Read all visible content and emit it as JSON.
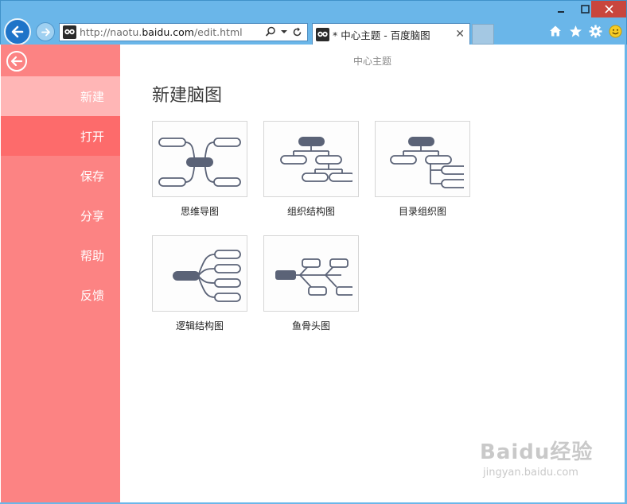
{
  "browser": {
    "url_prefix": "http://naotu.",
    "url_domain": "baidu.com",
    "url_path": "/edit.html",
    "tab_title": "* 中心主题 - 百度脑图",
    "window_controls": [
      "minimize-icon",
      "maximize-icon",
      "close-icon"
    ],
    "toolbar_icons": [
      "home-icon",
      "favorites-star-icon",
      "settings-gear-icon",
      "feedback-smiley-icon"
    ]
  },
  "sidebar": {
    "items": [
      {
        "label": "新建",
        "state": "selected"
      },
      {
        "label": "打开",
        "state": "hover"
      },
      {
        "label": "保存",
        "state": "normal"
      },
      {
        "label": "分享",
        "state": "normal"
      },
      {
        "label": "帮助",
        "state": "normal"
      },
      {
        "label": "反馈",
        "state": "normal"
      }
    ]
  },
  "main": {
    "doc_title": "中心主题",
    "heading": "新建脑图",
    "templates": [
      {
        "label": "思维导图",
        "icon": "mind-map-icon"
      },
      {
        "label": "组织结构图",
        "icon": "org-chart-icon"
      },
      {
        "label": "目录组织图",
        "icon": "directory-chart-icon"
      },
      {
        "label": "逻辑结构图",
        "icon": "logic-chart-icon"
      },
      {
        "label": "鱼骨头图",
        "icon": "fishbone-chart-icon"
      }
    ]
  },
  "watermark": {
    "main": "Baidu经验",
    "sub": "jingyan.baidu.com"
  },
  "colors": {
    "sidebar": "#fc8383",
    "sidebar_selected": "#ffb6b6",
    "sidebar_hover": "#fd6b6b",
    "chrome": "#6ab6e9",
    "node_dark": "#5b6377"
  }
}
